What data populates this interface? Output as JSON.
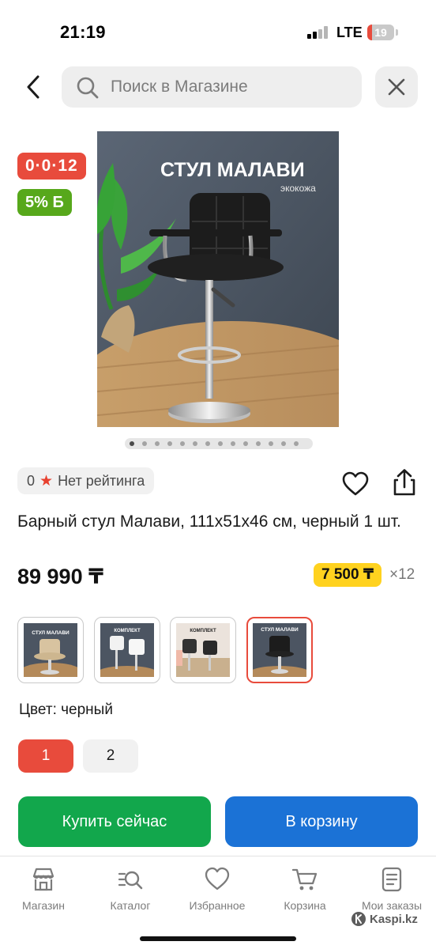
{
  "status_bar": {
    "time": "21:19",
    "network": "LTE",
    "battery_level": "19",
    "battery_fraction": 0.19
  },
  "search": {
    "placeholder": "Поиск в Магазине",
    "icons": {
      "back": "chevron-left-icon",
      "search": "search-icon",
      "close": "close-icon"
    }
  },
  "product": {
    "image_overlay_title": "СТУЛ МАЛАВИ",
    "image_overlay_subtitle": "экокожа",
    "installment_badge": "0·0·12",
    "bonus_badge": "5% Б",
    "pager": {
      "count": 14,
      "active_index": 0
    },
    "rating_count": "0",
    "rating_label": "Нет рейтинга",
    "title": "Барный стул Малави, 111x51x46 см, черный 1 шт.",
    "price": "89 990 ₸",
    "monthly_payment": "7 500 ₸",
    "months": "×12",
    "thumbnails": [
      {
        "name": "thumb-beige",
        "selected": false
      },
      {
        "name": "thumb-white",
        "selected": false
      },
      {
        "name": "thumb-set",
        "selected": false
      },
      {
        "name": "thumb-black",
        "selected": true
      }
    ],
    "color_label": "Цвет: черный",
    "variants": [
      "1",
      "2"
    ],
    "selected_variant": "1"
  },
  "actions": {
    "buy_now": "Купить сейчас",
    "add_to_cart": "В корзину"
  },
  "tab_bar": {
    "items": [
      {
        "label": "Магазин",
        "icon": "store-icon"
      },
      {
        "label": "Каталог",
        "icon": "catalog-search-icon"
      },
      {
        "label": "Избранное",
        "icon": "heart-icon"
      },
      {
        "label": "Корзина",
        "icon": "cart-icon"
      },
      {
        "label": "Мои заказы",
        "icon": "orders-icon"
      }
    ]
  },
  "watermark": "Kaspi.kz",
  "colors": {
    "accent_red": "#e84b3c",
    "bonus_green": "#57a81b",
    "buy_green": "#12a74c",
    "cart_blue": "#1b72d6",
    "installment_yellow": "#ffd21f"
  }
}
